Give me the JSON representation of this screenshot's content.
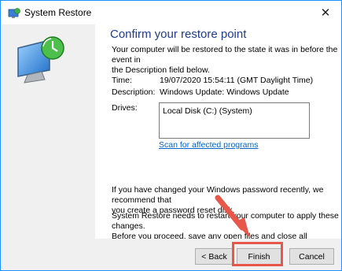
{
  "window": {
    "title": "System Restore"
  },
  "content": {
    "heading": "Confirm your restore point",
    "intro_line1": "Your computer will be restored to the state it was in before the event in",
    "intro_line2": "the Description field below.",
    "time_label": "Time:",
    "time_value": "19/07/2020 15:54:11 (GMT Daylight Time)",
    "description_label": "Description:",
    "description_value": "Windows Update: Windows Update",
    "drives_label": "Drives:",
    "drives": [
      "Local Disk (C:) (System)"
    ],
    "scan_link": "Scan for affected programs",
    "password_line1": "If you have changed your Windows password recently, we recommend that",
    "password_line2": "you create a password reset disk.",
    "restart_line1": "System Restore needs to restart your computer to apply these changes.",
    "restart_line2": "Before you proceed, save any open files and close all programs."
  },
  "buttons": {
    "back": "< Back",
    "finish": "Finish",
    "cancel": "Cancel"
  },
  "colors": {
    "heading": "#1e3c8c",
    "link": "#0066cc",
    "highlight": "#e8584a"
  }
}
